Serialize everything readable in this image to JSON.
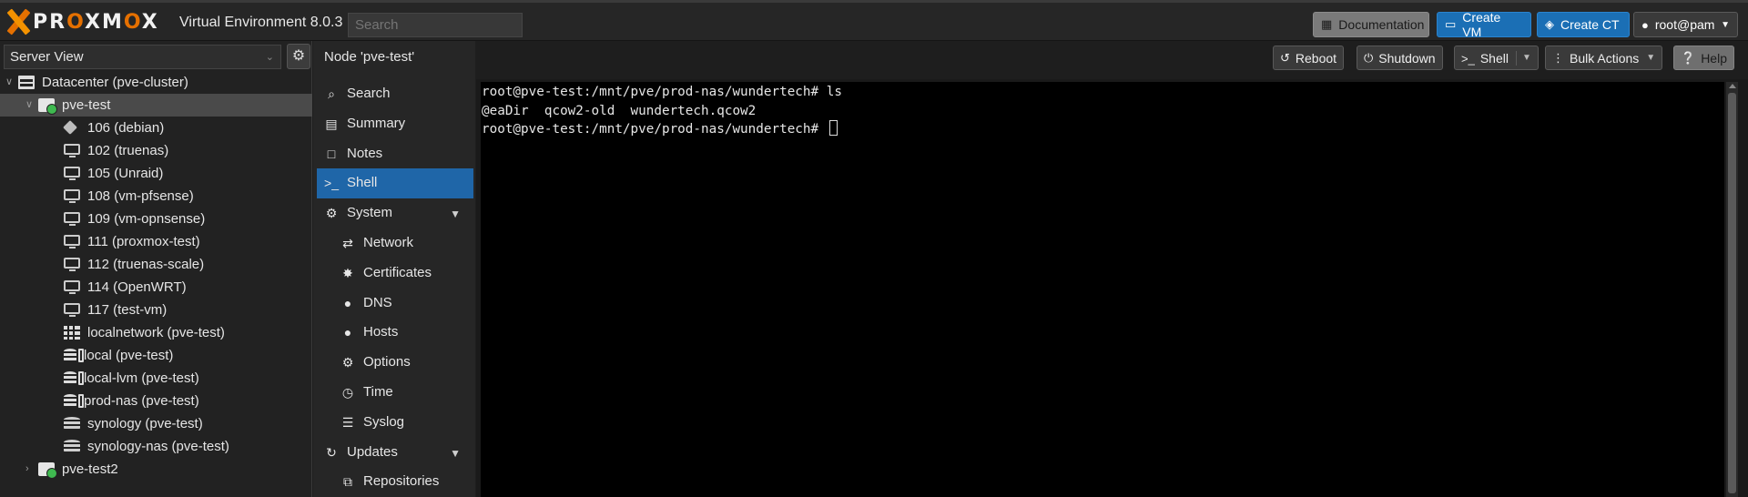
{
  "header": {
    "brand_prefix": "PR",
    "brand_o1": "O",
    "brand_mid": "XM",
    "brand_o2": "O",
    "brand_suffix": "X",
    "version": "Virtual Environment 8.0.3",
    "search_placeholder": "Search",
    "buttons": {
      "documentation": "Documentation",
      "create_vm": "Create VM",
      "create_ct": "Create CT",
      "user": "root@pam"
    }
  },
  "sidebar": {
    "view_select": "Server View",
    "tree": [
      {
        "label": "Datacenter (pve-cluster)",
        "icon": "datacenter-icon",
        "level": 0,
        "expanded": true
      },
      {
        "label": "pve-test",
        "icon": "node-online-icon",
        "level": 1,
        "expanded": true,
        "selected": true
      },
      {
        "label": "106 (debian)",
        "icon": "container-icon",
        "level": 2
      },
      {
        "label": "102 (truenas)",
        "icon": "vm-monitor-icon",
        "level": 2
      },
      {
        "label": "105 (Unraid)",
        "icon": "vm-monitor-icon",
        "level": 2
      },
      {
        "label": "108 (vm-pfsense)",
        "icon": "vm-monitor-icon",
        "level": 2
      },
      {
        "label": "109 (vm-opnsense)",
        "icon": "vm-monitor-icon",
        "level": 2
      },
      {
        "label": "111 (proxmox-test)",
        "icon": "vm-monitor-icon",
        "level": 2
      },
      {
        "label": "112 (truenas-scale)",
        "icon": "vm-monitor-icon",
        "level": 2
      },
      {
        "label": "114 (OpenWRT)",
        "icon": "vm-monitor-icon",
        "level": 2
      },
      {
        "label": "117 (test-vm)",
        "icon": "vm-monitor-icon",
        "level": 2
      },
      {
        "label": "localnetwork (pve-test)",
        "icon": "network-grid-icon",
        "level": 2
      },
      {
        "label": "local (pve-test)",
        "icon": "storage-icon",
        "level": 2
      },
      {
        "label": "local-lvm (pve-test)",
        "icon": "storage-icon",
        "level": 2
      },
      {
        "label": "prod-nas (pve-test)",
        "icon": "storage-icon",
        "level": 2
      },
      {
        "label": "synology (pve-test)",
        "icon": "shared-storage-icon",
        "level": 2
      },
      {
        "label": "synology-nas (pve-test)",
        "icon": "shared-storage-icon",
        "level": 2
      },
      {
        "label": "pve-test2",
        "icon": "node-online-icon",
        "level": 1,
        "expanded": false
      }
    ]
  },
  "node_panel": {
    "title": "Node 'pve-test'",
    "nav": [
      {
        "label": "Search",
        "icon": "search-icon",
        "sub": false
      },
      {
        "label": "Summary",
        "icon": "book-icon",
        "sub": false
      },
      {
        "label": "Notes",
        "icon": "notes-icon",
        "sub": false
      },
      {
        "label": "Shell",
        "icon": "terminal-icon",
        "sub": false,
        "selected": true
      },
      {
        "label": "System",
        "icon": "cogs-icon",
        "sub": false,
        "expandable": true
      },
      {
        "label": "Network",
        "icon": "exchange-icon",
        "sub": true
      },
      {
        "label": "Certificates",
        "icon": "certificate-icon",
        "sub": true
      },
      {
        "label": "DNS",
        "icon": "globe-icon",
        "sub": true
      },
      {
        "label": "Hosts",
        "icon": "globe-icon",
        "sub": true
      },
      {
        "label": "Options",
        "icon": "gear-icon",
        "sub": true
      },
      {
        "label": "Time",
        "icon": "clock-icon",
        "sub": true
      },
      {
        "label": "Syslog",
        "icon": "list-icon",
        "sub": true
      },
      {
        "label": "Updates",
        "icon": "refresh-icon",
        "sub": false,
        "expandable": true
      },
      {
        "label": "Repositories",
        "icon": "files-icon",
        "sub": true
      }
    ]
  },
  "toolbar": {
    "reboot": "Reboot",
    "shutdown": "Shutdown",
    "shell": "Shell",
    "bulk_actions": "Bulk Actions",
    "help": "Help"
  },
  "terminal": {
    "lines": [
      "root@pve-test:/mnt/pve/prod-nas/wundertech# ls",
      "@eaDir  qcow2-old  wundertech.qcow2",
      "root@pve-test:/mnt/pve/prod-nas/wundertech# "
    ]
  },
  "colors": {
    "accent": "#e57000",
    "selection_blue": "#1f66a8",
    "button_blue": "#1b6fb5",
    "status_online": "#3fb950"
  }
}
